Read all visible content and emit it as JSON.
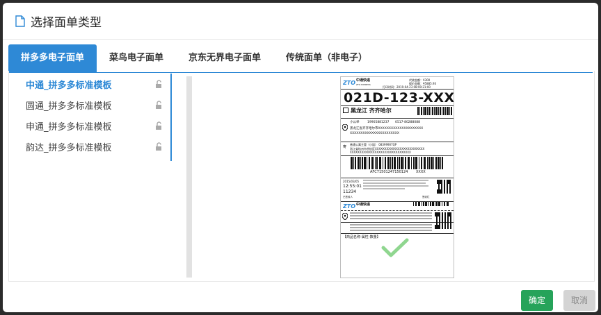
{
  "dialog": {
    "title": "选择面单类型"
  },
  "tabs": [
    "拼多多电子面单",
    "菜鸟电子面单",
    "京东无界电子面单",
    "传统面单（非电子）"
  ],
  "templates": [
    "中通_拼多多标准模板",
    "圆通_拼多多标准模板",
    "申通_拼多多标准模板",
    "韵达_拼多多标准模板"
  ],
  "preview": {
    "brand": "中通快递",
    "brand_en": "ZTO EXPRESS",
    "fee_label": "代收金额：¥300",
    "insure_label": "保价金额：¥5885.93",
    "print_time": "打印时间：2019-04-23 08:00:21:00",
    "sort_code": "021D-123-XXX",
    "region": "黑龙江  齐齐哈尔",
    "recv_name": "小公举",
    "recv_phone": "19905881237",
    "recv_tel": "0517-80288088",
    "recv_addr": "黑龙江省齐齐哈尔市XXXXXXXXXXXXXXXXXXXXX",
    "recv_addr2": "XXXXXXXXXXXXXXXXXXXXXXX",
    "send_label": "寄",
    "send_line": "普通公寓主管（小姐）  08399907QP",
    "send_addr": "浙江省杭州市余杭区XXXXXXXXXXXXXXXXXXXXXXXXXX",
    "send_addr2": "XXXXXXXXXXXXXXXXXXXXXXXXXXXXXXXX",
    "tracking": "AFC71501247150124",
    "tracking_suffix": "XXXX",
    "date": "2015/03/05",
    "time": "12:55:01",
    "num": "11234",
    "signed_label": "已签收人",
    "sign_label": "签收栏",
    "goods_label": "【商品名称-属性-数量】",
    "qr_label": "扫描关注"
  },
  "buttons": {
    "ok": "确定",
    "cancel": "取消"
  },
  "colors": {
    "primary": "#2e89d6",
    "ok": "#26a35a",
    "cancel": "#d4d4d4"
  }
}
